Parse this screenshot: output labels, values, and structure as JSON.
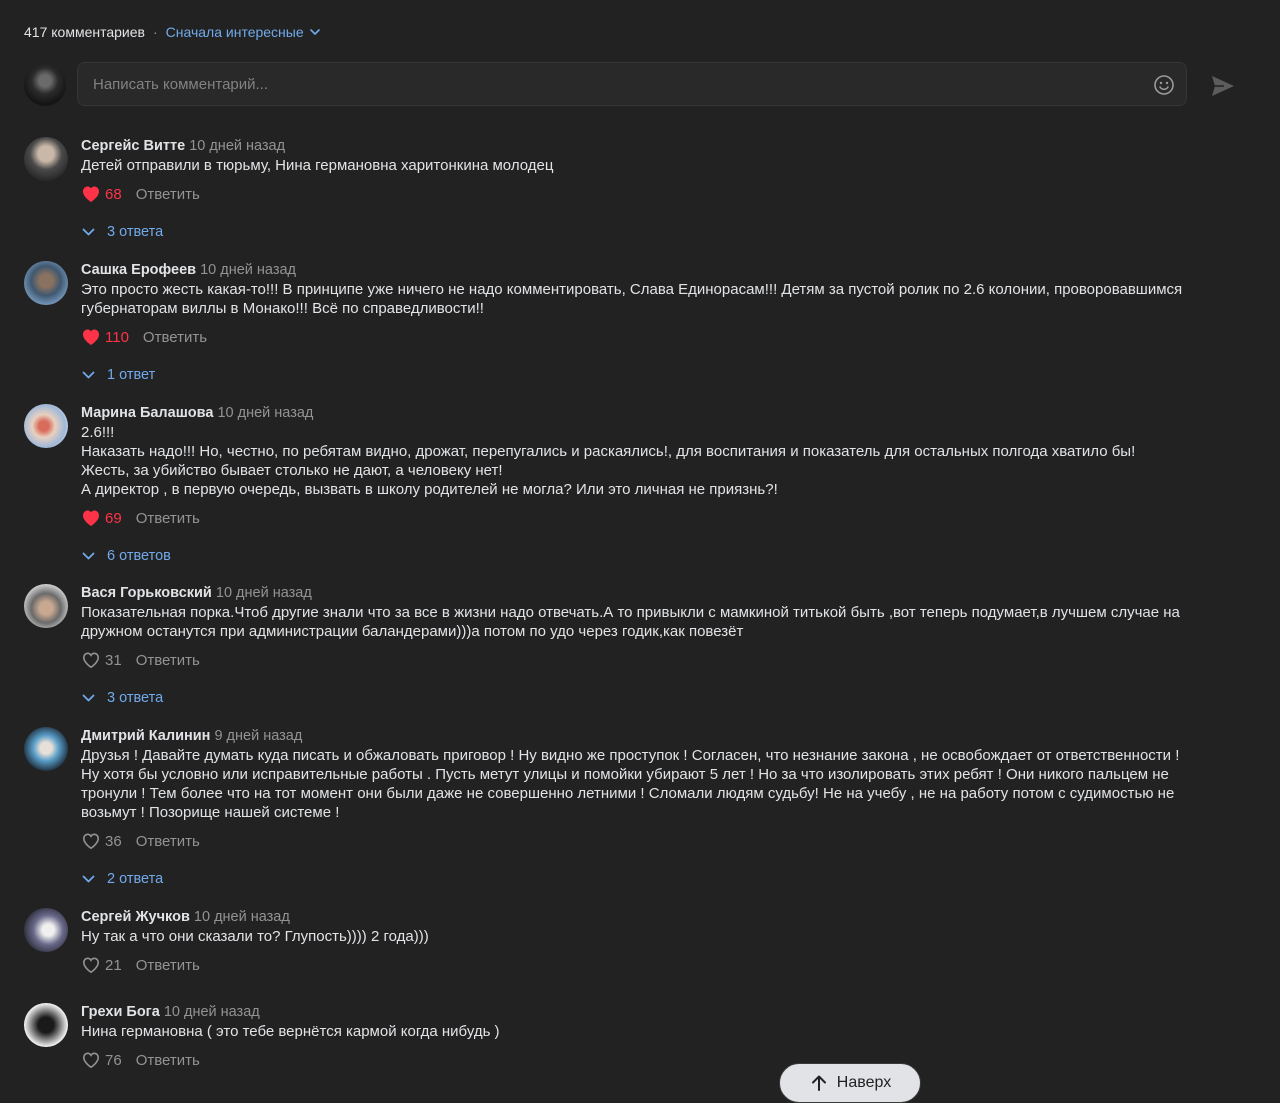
{
  "header": {
    "count_label": "417 комментариев",
    "separator": "·",
    "sort_label": "Сначала интересные"
  },
  "compose": {
    "placeholder": "Написать комментарий..."
  },
  "comments": [
    {
      "author": "Сергейс Витте",
      "time": "10 дней назад",
      "lines": [
        "Детей отправили в тюрьму, Нина германовна харитонкина молодец"
      ],
      "likes": "68",
      "liked": true,
      "reply_label": "Ответить",
      "replies_label": "3 ответа"
    },
    {
      "author": "Сашка Ерофеев",
      "time": "10 дней назад",
      "lines": [
        "Это просто жесть какая-то!!! В принципе уже ничего не надо комментировать, Слава Единорасам!!! Детям за пустой ролик по 2.6 колонии, проворовавшимся",
        "губернаторам виллы в Монако!!! Всё по справедливости!!"
      ],
      "likes": "110",
      "liked": true,
      "reply_label": "Ответить",
      "replies_label": "1 ответ"
    },
    {
      "author": "Марина Балашова",
      "time": "10 дней назад",
      "lines": [
        "2.6!!!",
        "Наказать надо!!! Но, честно, по ребятам видно, дрожат, перепугались и раскаялись!, для воспитания и показатель для остальных полгода хватило бы!",
        "Жесть, за убийство бывает столько не дают, а человеку нет!",
        "А директор , в первую очередь, вызвать в школу родителей не могла? Или это личная не приязнь?!"
      ],
      "likes": "69",
      "liked": true,
      "reply_label": "Ответить",
      "replies_label": "6 ответов"
    },
    {
      "author": "Вася Горьковский",
      "time": "10 дней назад",
      "lines": [
        "Показательная порка.Чтоб другие знали что за все в жизни надо отвечать.А то привыкли с мамкиной титькой быть ,вот теперь подумает,в лучшем случае на",
        "дружном останутся при администрации баландерами)))а потом по удо через годик,как повезёт"
      ],
      "likes": "31",
      "liked": false,
      "reply_label": "Ответить",
      "replies_label": "3 ответа"
    },
    {
      "author": "Дмитрий Калинин",
      "time": "9 дней назад",
      "lines": [
        "Друзья ! Давайте думать куда писать и обжаловать приговор ! Ну видно же проступок ! Согласен, что незнание закона , не освобождает от ответственности !",
        "Ну хотя бы условно или исправительные работы . Пусть метут улицы и помойки убирают 5 лет ! Но за что изолировать этих ребят ! Они никого пальцем не",
        "тронули ! Тем более что на тот момент они были даже не совершенно летними ! Сломали людям судьбу! Не на учебу , не на работу потом с судимостью не",
        "возьмут ! Позорище нашей системе !"
      ],
      "likes": "36",
      "liked": false,
      "reply_label": "Ответить",
      "replies_label": "2 ответа"
    },
    {
      "author": "Сергей Жучков",
      "time": "10 дней назад",
      "lines": [
        "Ну так а что они сказали то? Глупость)))) 2 года)))"
      ],
      "likes": "21",
      "liked": false,
      "reply_label": "Ответить",
      "replies_label": ""
    },
    {
      "author": "Грехи Бога",
      "time": "10 дней назад",
      "lines": [
        "Нина германовна ( это тебе вернётся кармой когда нибудь )"
      ],
      "likes": "76",
      "liked": false,
      "reply_label": "Ответить",
      "replies_label": ""
    }
  ],
  "to_top": {
    "label": "Наверх"
  },
  "colors": {
    "background": "#222222",
    "link": "#71aaeb",
    "like_active": "#ff3347",
    "muted": "#939393"
  }
}
